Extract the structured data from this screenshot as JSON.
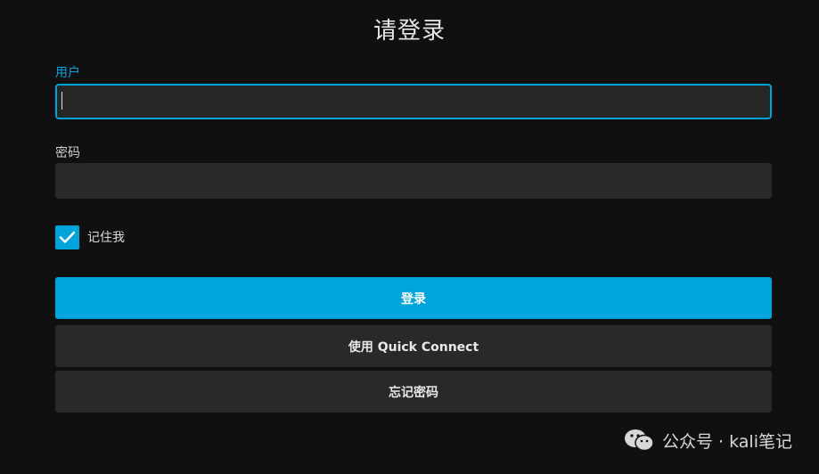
{
  "title": "请登录",
  "username": {
    "label": "用户",
    "value": ""
  },
  "password": {
    "label": "密码",
    "value": ""
  },
  "remember": {
    "label": "记住我",
    "checked": true
  },
  "buttons": {
    "login": "登录",
    "quick_connect": "使用 Quick Connect",
    "forgot_password": "忘记密码"
  },
  "watermark": {
    "text": "公众号 · kali笔记",
    "icon": "wechat-icon"
  },
  "colors": {
    "accent": "#00a4dc",
    "background": "#101010",
    "field": "#292929"
  }
}
